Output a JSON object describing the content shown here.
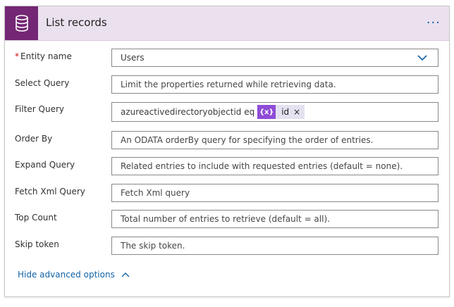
{
  "header": {
    "title": "List records",
    "more_options": "···",
    "icon": "database-icon"
  },
  "fields": [
    {
      "label": "Entity name",
      "required": true,
      "value": "Users"
    },
    {
      "label": "Select Query",
      "placeholder": "Limit the properties returned while retrieving data."
    },
    {
      "label": "Filter Query",
      "value": "azureactivedirectoryobjectid eq",
      "token": {
        "label": "id",
        "icon_text": "{x}",
        "close": "×"
      }
    },
    {
      "label": "Order By",
      "placeholder": "An ODATA orderBy query for specifying the order of entries."
    },
    {
      "label": "Expand Query",
      "placeholder": "Related entries to include with requested entries (default = none)."
    },
    {
      "label": "Fetch Xml Query",
      "placeholder": "Fetch Xml query"
    },
    {
      "label": "Top Count",
      "placeholder": "Total number of entries to retrieve (default = all)."
    },
    {
      "label": "Skip token",
      "placeholder": "The skip token."
    }
  ],
  "footer": {
    "hide_advanced_label": "Hide advanced options"
  },
  "colors": {
    "header_bg": "#ebe1ee",
    "icon_bg": "#742774",
    "token_icon_bg": "#8f4cd6",
    "link": "#0f62a8",
    "required": "#c40e0e"
  }
}
